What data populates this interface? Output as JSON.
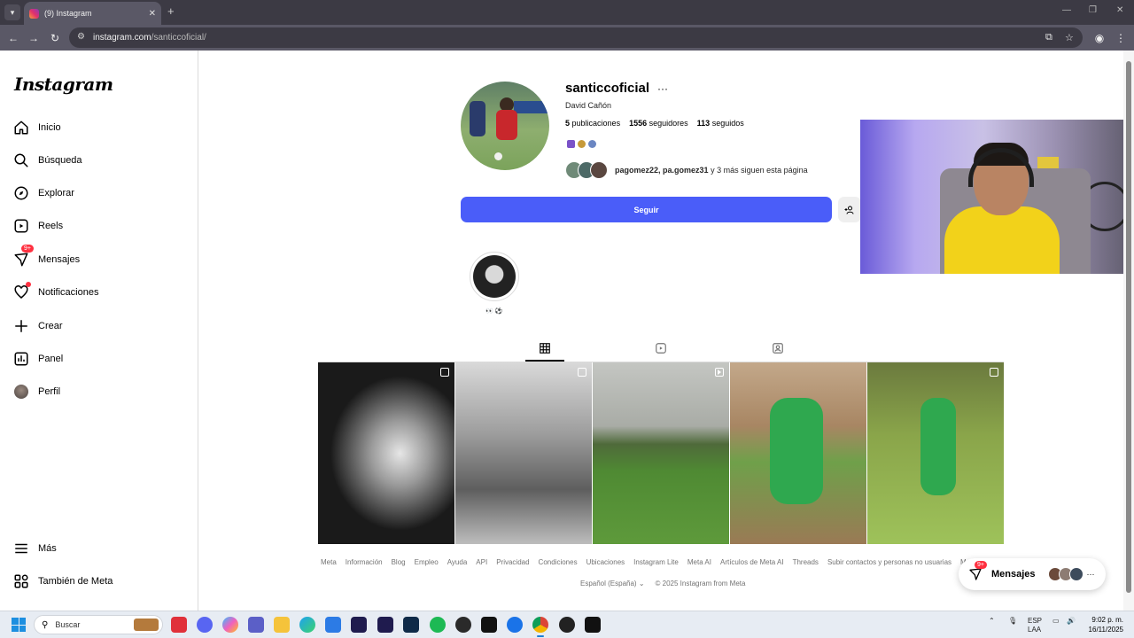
{
  "browser": {
    "tab_title": "(9) Instagram",
    "url_host": "instagram.com",
    "url_path": "/santiccoficial/"
  },
  "sidebar": {
    "logo": "Instagram",
    "items": [
      {
        "label": "Inicio",
        "icon": "home-icon"
      },
      {
        "label": "Búsqueda",
        "icon": "search-icon"
      },
      {
        "label": "Explorar",
        "icon": "compass-icon"
      },
      {
        "label": "Reels",
        "icon": "reels-icon"
      },
      {
        "label": "Mensajes",
        "icon": "messenger-icon",
        "badge": "9+"
      },
      {
        "label": "Notificaciones",
        "icon": "heart-icon"
      },
      {
        "label": "Crear",
        "icon": "plus-icon"
      },
      {
        "label": "Panel",
        "icon": "chart-icon"
      },
      {
        "label": "Perfil",
        "icon": "avatar"
      }
    ],
    "bottom_items": [
      {
        "label": "Más",
        "icon": "hamburger-icon"
      },
      {
        "label": "También de Meta",
        "icon": "meta-icon"
      }
    ]
  },
  "profile": {
    "username": "santiccoficial",
    "full_name": "David Cañón",
    "posts_count": "5",
    "posts_label": "publicaciones",
    "followers_count": "1556",
    "followers_label": "seguidores",
    "following_count": "113",
    "following_label": "seguidos",
    "followed_by_users": "pagomez22, pa.gomez31",
    "followed_by_suffix": "y 3 más siguen esta página",
    "follow_button": "Seguir",
    "highlight_label": "👀 ⚽"
  },
  "footer": {
    "links": [
      "Meta",
      "Información",
      "Blog",
      "Empleo",
      "Ayuda",
      "API",
      "Privacidad",
      "Condiciones",
      "Ubicaciones",
      "Instagram Lite",
      "Meta AI",
      "Artículos de Meta AI",
      "Threads",
      "Subir contactos y personas no usuarias",
      "M"
    ],
    "language": "Español (España)",
    "copyright": "© 2025 Instagram from Meta"
  },
  "messages_pill": {
    "label": "Mensajes",
    "badge": "9+"
  },
  "taskbar": {
    "search_placeholder": "Buscar",
    "lang_top": "ESP",
    "lang_bottom": "LAA",
    "time": "9:02 p. m.",
    "date": "16/11/2025"
  },
  "colors": {
    "follow_button": "#4a5df9",
    "badge": "#ff3040"
  }
}
